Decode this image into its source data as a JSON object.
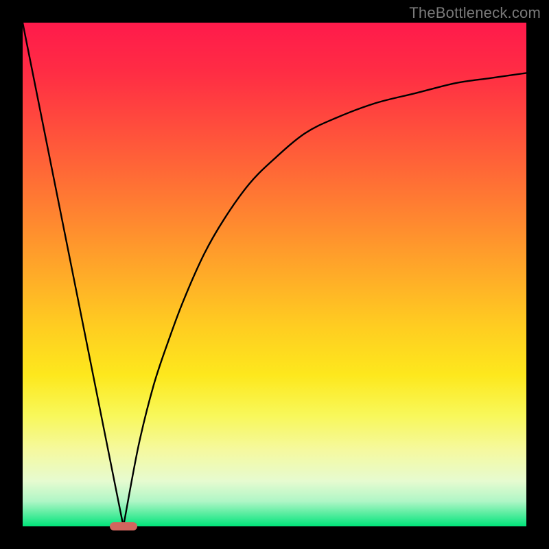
{
  "attribution": "TheBottleneck.com",
  "chart_data": {
    "type": "line",
    "title": "",
    "xlabel": "",
    "ylabel": "",
    "xlim": [
      0,
      1
    ],
    "ylim": [
      0,
      1
    ],
    "grid": false,
    "legend": false,
    "curve": {
      "left": {
        "x": [
          0.0,
          0.2
        ],
        "y": [
          1.0,
          0.0
        ]
      },
      "right_x": [
        0.2,
        0.23,
        0.26,
        0.29,
        0.32,
        0.36,
        0.4,
        0.45,
        0.5,
        0.56,
        0.62,
        0.7,
        0.78,
        0.86,
        0.93,
        1.0
      ],
      "right_y": [
        0.0,
        0.16,
        0.28,
        0.37,
        0.45,
        0.54,
        0.61,
        0.68,
        0.73,
        0.78,
        0.81,
        0.84,
        0.86,
        0.88,
        0.89,
        0.9
      ]
    },
    "marker": {
      "x": 0.2,
      "y": 0.0,
      "shape": "pill",
      "color": "#d2655e"
    },
    "colors": {
      "background_gradient": [
        "#ff1a4b",
        "#ff6a36",
        "#ffcc21",
        "#f8f85a",
        "#00e47a"
      ],
      "frame": "#000000",
      "curve_stroke": "#000000"
    }
  }
}
